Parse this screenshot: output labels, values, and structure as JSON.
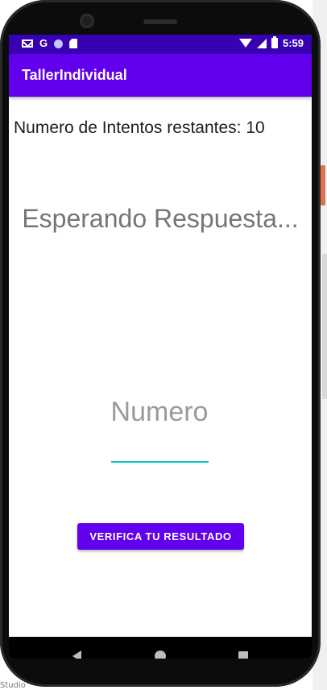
{
  "status_bar": {
    "time": "5:59",
    "left_icons": [
      "gmail-icon",
      "google-icon",
      "circle-app-icon",
      "sd-card-icon"
    ],
    "right_icons": [
      "wifi-icon",
      "signal-icon",
      "battery-icon"
    ],
    "google_glyph": "G"
  },
  "app_bar": {
    "title": "TallerIndividual"
  },
  "main": {
    "attempts_text": "Numero de Intentos restantes: 10",
    "response_text": "Esperando Respuesta...",
    "number_input": {
      "placeholder": "Numero",
      "value": ""
    },
    "verify_button_label": "VERIFICA TU RESULTADO"
  },
  "navigation": [
    "back-icon",
    "home-icon",
    "recent-apps-icon"
  ],
  "colors": {
    "status_bar": "#3700b3",
    "primary": "#6200ee",
    "input_underline": "#03c4c8",
    "placeholder_text": "#9a9a9a"
  },
  "background": {
    "bottom_label": "Studio"
  }
}
